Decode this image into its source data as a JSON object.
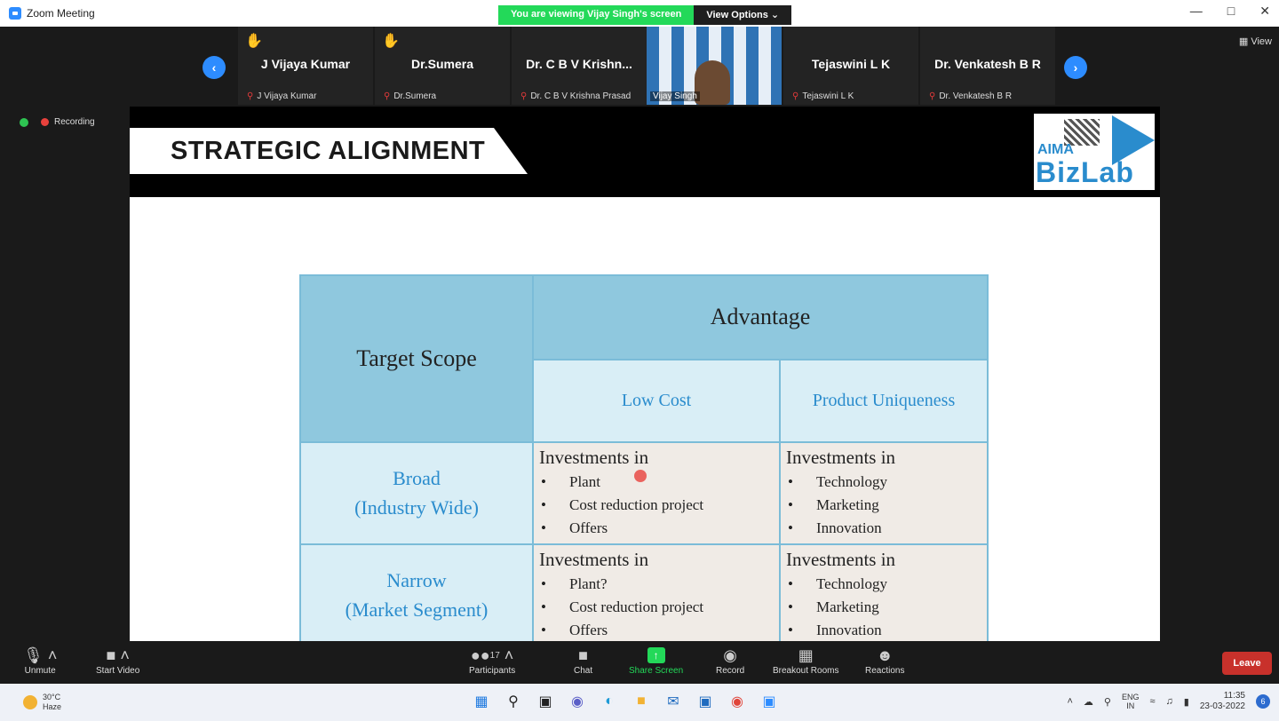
{
  "window": {
    "title": "Zoom Meeting",
    "viewing_banner": "You are viewing Vijay Singh's screen",
    "view_options": "View Options ⌄"
  },
  "participants": [
    {
      "name": "J Vijaya Kumar",
      "label": "J Vijaya Kumar",
      "hand_raised": true
    },
    {
      "name": "Dr.Sumera",
      "label": "Dr.Sumera",
      "hand_raised": true
    },
    {
      "name": "Dr. C B V Krishn...",
      "label": "Dr. C B V Krishna Prasad",
      "hand_raised": false
    },
    {
      "name": "",
      "label": "Vijay Singh",
      "video_on": true
    },
    {
      "name": "Tejaswini L K",
      "label": "Tejaswini L K",
      "hand_raised": false
    },
    {
      "name": "Dr. Venkatesh B R",
      "label": "Dr. Venkatesh B R",
      "hand_raised": false
    }
  ],
  "view_button": "View",
  "recording_label": "Recording",
  "slide": {
    "title": "STRATEGIC ALIGNMENT",
    "logo_top": "AIMA",
    "logo_bottom": "BizLab",
    "matrix": {
      "row_header": "Target Scope",
      "column_header": "Advantage",
      "sub_headers": [
        "Low Cost",
        "Product Uniqueness"
      ],
      "rows": [
        {
          "label_line1": "Broad",
          "label_line2": "(Industry Wide)",
          "low_cost": {
            "heading": "Investments in",
            "items": [
              "Plant",
              "Cost reduction project",
              "Offers"
            ]
          },
          "uniqueness": {
            "heading": "Investments in",
            "items": [
              "Technology",
              "Marketing",
              "Innovation"
            ]
          }
        },
        {
          "label_line1": "Narrow",
          "label_line2": "(Market Segment)",
          "low_cost": {
            "heading": "Investments in",
            "items": [
              "Plant?",
              "Cost reduction project",
              "Offers"
            ]
          },
          "uniqueness": {
            "heading": "Investments in",
            "items": [
              "Technology",
              "Marketing",
              "Innovation"
            ]
          }
        }
      ]
    }
  },
  "controls": {
    "unmute": "Unmute",
    "start_video": "Start Video",
    "participants": "Participants",
    "participant_count": "17",
    "chat": "Chat",
    "share_screen": "Share Screen",
    "record": "Record",
    "breakout_rooms": "Breakout Rooms",
    "reactions": "Reactions",
    "leave": "Leave"
  },
  "taskbar": {
    "temperature": "30°C",
    "weather": "Haze",
    "lang_top": "ENG",
    "lang_bottom": "IN",
    "time": "11:35",
    "date": "23-03-2022",
    "notification_count": "6"
  },
  "colors": {
    "zoom_blue": "#2d8cff",
    "banner_green": "#23d959",
    "leave_red": "#c8312b",
    "table_header": "#8fc8de",
    "table_light": "#d9eef6",
    "table_cell": "#f0ebe6",
    "accent_text": "#2a8ccd"
  }
}
